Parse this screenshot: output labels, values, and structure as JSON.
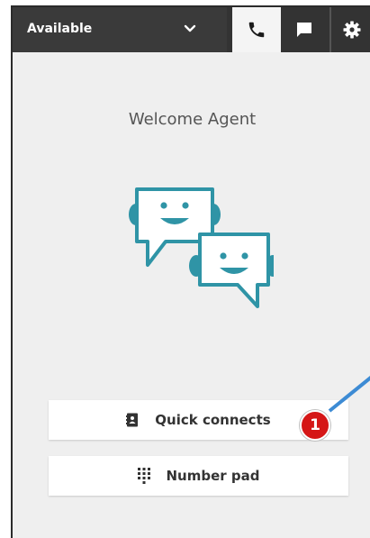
{
  "header": {
    "status_label": "Available",
    "tabs": [
      {
        "name": "phone",
        "icon": "phone-icon",
        "active": true
      },
      {
        "name": "chat",
        "icon": "chat-icon",
        "active": false
      },
      {
        "name": "settings",
        "icon": "gear-icon",
        "active": false
      }
    ]
  },
  "main": {
    "welcome": "Welcome Agent",
    "illustration": "chat-bots-illustration"
  },
  "actions": {
    "quick_connects_label": "Quick connects",
    "number_pad_label": "Number pad"
  },
  "annotation": {
    "badge": "1"
  },
  "colors": {
    "topbar": "#333333",
    "illustration": "#2f94a6",
    "badge": "#d51616",
    "pointer": "#3d8bd4"
  }
}
